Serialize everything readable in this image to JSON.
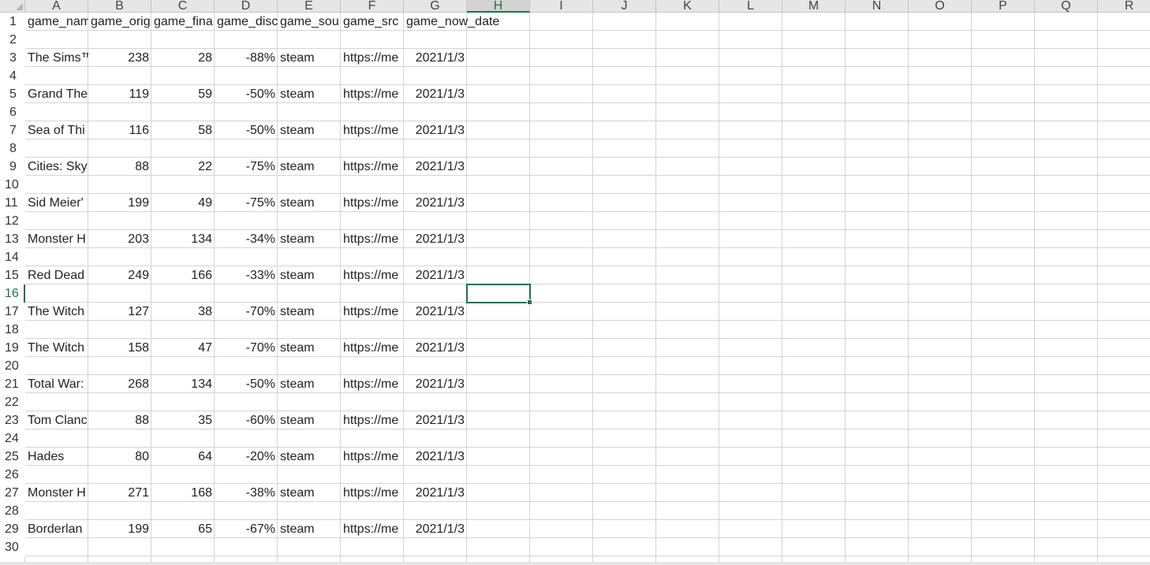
{
  "columns": [
    "A",
    "B",
    "C",
    "D",
    "E",
    "F",
    "G",
    "H",
    "I",
    "J",
    "K",
    "L",
    "M",
    "N",
    "O",
    "P",
    "Q",
    "R"
  ],
  "active_column": "H",
  "rows": [
    "1",
    "2",
    "3",
    "4",
    "5",
    "6",
    "7",
    "8",
    "9",
    "10",
    "11",
    "12",
    "13",
    "14",
    "15",
    "16",
    "17",
    "18",
    "19",
    "20",
    "21",
    "22",
    "23",
    "24",
    "25",
    "26",
    "27",
    "28",
    "29",
    "30"
  ],
  "active_row": "16",
  "headers": [
    "game_name",
    "game_orig",
    "game_fina",
    "game_disc",
    "game_sou",
    "game_src",
    "game_now_date"
  ],
  "records": [
    {
      "row": 3,
      "cells": [
        "The Sims™",
        "238",
        "28",
        "-88%",
        "steam",
        "https://me",
        "2021/1/3"
      ]
    },
    {
      "row": 5,
      "cells": [
        "Grand The",
        "119",
        "59",
        "-50%",
        "steam",
        "https://me",
        "2021/1/3"
      ]
    },
    {
      "row": 7,
      "cells": [
        "Sea of Thi",
        "116",
        "58",
        "-50%",
        "steam",
        "https://me",
        "2021/1/3"
      ]
    },
    {
      "row": 9,
      "cells": [
        "Cities: Sky",
        "88",
        "22",
        "-75%",
        "steam",
        "https://me",
        "2021/1/3"
      ]
    },
    {
      "row": 11,
      "cells": [
        "Sid Meier'",
        "199",
        "49",
        "-75%",
        "steam",
        "https://me",
        "2021/1/3"
      ]
    },
    {
      "row": 13,
      "cells": [
        "Monster H",
        "203",
        "134",
        "-34%",
        "steam",
        "https://me",
        "2021/1/3"
      ]
    },
    {
      "row": 15,
      "cells": [
        "Red Dead",
        "249",
        "166",
        "-33%",
        "steam",
        "https://me",
        "2021/1/3"
      ]
    },
    {
      "row": 17,
      "cells": [
        "The Witch",
        "127",
        "38",
        "-70%",
        "steam",
        "https://me",
        "2021/1/3"
      ]
    },
    {
      "row": 19,
      "cells": [
        "The Witch",
        "158",
        "47",
        "-70%",
        "steam",
        "https://me",
        "2021/1/3"
      ]
    },
    {
      "row": 21,
      "cells": [
        "Total War:",
        "268",
        "134",
        "-50%",
        "steam",
        "https://me",
        "2021/1/3"
      ]
    },
    {
      "row": 23,
      "cells": [
        "Tom Clanc",
        "88",
        "35",
        "-60%",
        "steam",
        "https://me",
        "2021/1/3"
      ]
    },
    {
      "row": 25,
      "cells": [
        "Hades",
        "80",
        "64",
        "-20%",
        "steam",
        "https://me",
        "2021/1/3"
      ]
    },
    {
      "row": 27,
      "cells": [
        "Monster H",
        "271",
        "168",
        "-38%",
        "steam",
        "https://me",
        "2021/1/3"
      ]
    },
    {
      "row": 29,
      "cells": [
        "Borderlan",
        "199",
        "65",
        "-67%",
        "steam",
        "https://me",
        "2021/1/3"
      ]
    }
  ],
  "selected_cell": "H16",
  "colors": {
    "accent": "#217346",
    "grid": "#d4d4d4",
    "header_bg": "#e6e6e6"
  }
}
